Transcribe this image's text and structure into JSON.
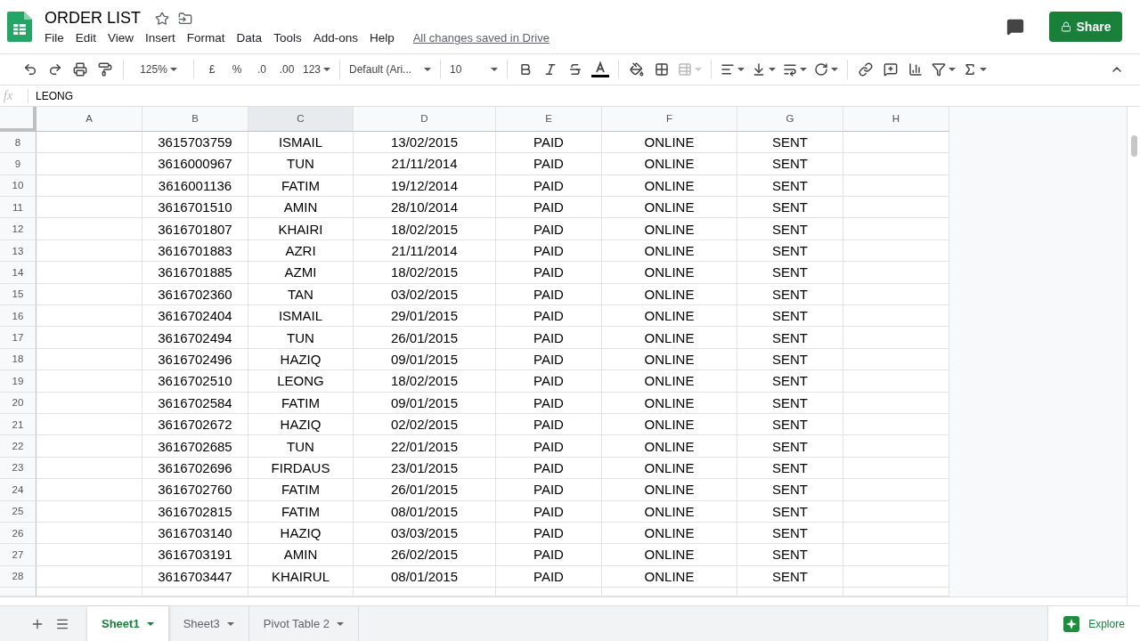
{
  "document": {
    "title": "ORDER LIST",
    "save_status": "All changes saved in Drive"
  },
  "menu": [
    "File",
    "Edit",
    "View",
    "Insert",
    "Format",
    "Data",
    "Tools",
    "Add-ons",
    "Help"
  ],
  "share_button": "Share",
  "toolbar": {
    "zoom": "125%",
    "currency": "£",
    "percent": "%",
    "decrease_decimals": ".0",
    "increase_decimals": ".00",
    "number_format": "123",
    "font": "Default (Ari...",
    "font_size": "10"
  },
  "formula_bar": {
    "label": "fx",
    "value": "LEONG"
  },
  "columns": [
    {
      "label": "A",
      "selected": false
    },
    {
      "label": "B",
      "selected": false
    },
    {
      "label": "C",
      "selected": true
    },
    {
      "label": "D",
      "selected": false
    },
    {
      "label": "E",
      "selected": false
    },
    {
      "label": "F",
      "selected": false
    },
    {
      "label": "G",
      "selected": false
    },
    {
      "label": "H",
      "selected": false
    }
  ],
  "rows": [
    {
      "number": "8",
      "cells": [
        "3615703759",
        "ISMAIL",
        "13/02/2015",
        "PAID",
        "ONLINE",
        "SENT"
      ]
    },
    {
      "number": "9",
      "cells": [
        "3616000967",
        "TUN",
        "21/11/2014",
        "PAID",
        "ONLINE",
        "SENT"
      ]
    },
    {
      "number": "10",
      "cells": [
        "3616001136",
        "FATIM",
        "19/12/2014",
        "PAID",
        "ONLINE",
        "SENT"
      ]
    },
    {
      "number": "11",
      "cells": [
        "3616701510",
        "AMIN",
        "28/10/2014",
        "PAID",
        "ONLINE",
        "SENT"
      ]
    },
    {
      "number": "12",
      "cells": [
        "3616701807",
        "KHAIRI",
        "18/02/2015",
        "PAID",
        "ONLINE",
        "SENT"
      ]
    },
    {
      "number": "13",
      "cells": [
        "3616701883",
        "AZRI",
        "21/11/2014",
        "PAID",
        "ONLINE",
        "SENT"
      ]
    },
    {
      "number": "14",
      "cells": [
        "3616701885",
        "AZMI",
        "18/02/2015",
        "PAID",
        "ONLINE",
        "SENT"
      ]
    },
    {
      "number": "15",
      "cells": [
        "3616702360",
        "TAN",
        "03/02/2015",
        "PAID",
        "ONLINE",
        "SENT"
      ]
    },
    {
      "number": "16",
      "cells": [
        "3616702404",
        "ISMAIL",
        "29/01/2015",
        "PAID",
        "ONLINE",
        "SENT"
      ]
    },
    {
      "number": "17",
      "cells": [
        "3616702494",
        "TUN",
        "26/01/2015",
        "PAID",
        "ONLINE",
        "SENT"
      ]
    },
    {
      "number": "18",
      "cells": [
        "3616702496",
        "HAZIQ",
        "09/01/2015",
        "PAID",
        "ONLINE",
        "SENT"
      ]
    },
    {
      "number": "19",
      "cells": [
        "3616702510",
        "LEONG",
        "18/02/2015",
        "PAID",
        "ONLINE",
        "SENT"
      ]
    },
    {
      "number": "20",
      "cells": [
        "3616702584",
        "FATIM",
        "09/01/2015",
        "PAID",
        "ONLINE",
        "SENT"
      ]
    },
    {
      "number": "21",
      "cells": [
        "3616702672",
        "HAZIQ",
        "02/02/2015",
        "PAID",
        "ONLINE",
        "SENT"
      ]
    },
    {
      "number": "22",
      "cells": [
        "3616702685",
        "TUN",
        "22/01/2015",
        "PAID",
        "ONLINE",
        "SENT"
      ]
    },
    {
      "number": "23",
      "cells": [
        "3616702696",
        "FIRDAUS",
        "23/01/2015",
        "PAID",
        "ONLINE",
        "SENT"
      ]
    },
    {
      "number": "24",
      "cells": [
        "3616702760",
        "FATIM",
        "26/01/2015",
        "PAID",
        "ONLINE",
        "SENT"
      ]
    },
    {
      "number": "25",
      "cells": [
        "3616702815",
        "FATIM",
        "08/01/2015",
        "PAID",
        "ONLINE",
        "SENT"
      ]
    },
    {
      "number": "26",
      "cells": [
        "3616703140",
        "HAZIQ",
        "03/03/2015",
        "PAID",
        "ONLINE",
        "SENT"
      ]
    },
    {
      "number": "27",
      "cells": [
        "3616703191",
        "AMIN",
        "26/02/2015",
        "PAID",
        "ONLINE",
        "SENT"
      ]
    },
    {
      "number": "28",
      "cells": [
        "3616703447",
        "KHAIRUL",
        "08/01/2015",
        "PAID",
        "ONLINE",
        "SENT"
      ]
    }
  ],
  "sheet_tabs": [
    {
      "label": "Sheet1",
      "selected": true
    },
    {
      "label": "Sheet3",
      "selected": false
    },
    {
      "label": "Pivot Table 2",
      "selected": false
    }
  ],
  "explore_button": "Explore"
}
